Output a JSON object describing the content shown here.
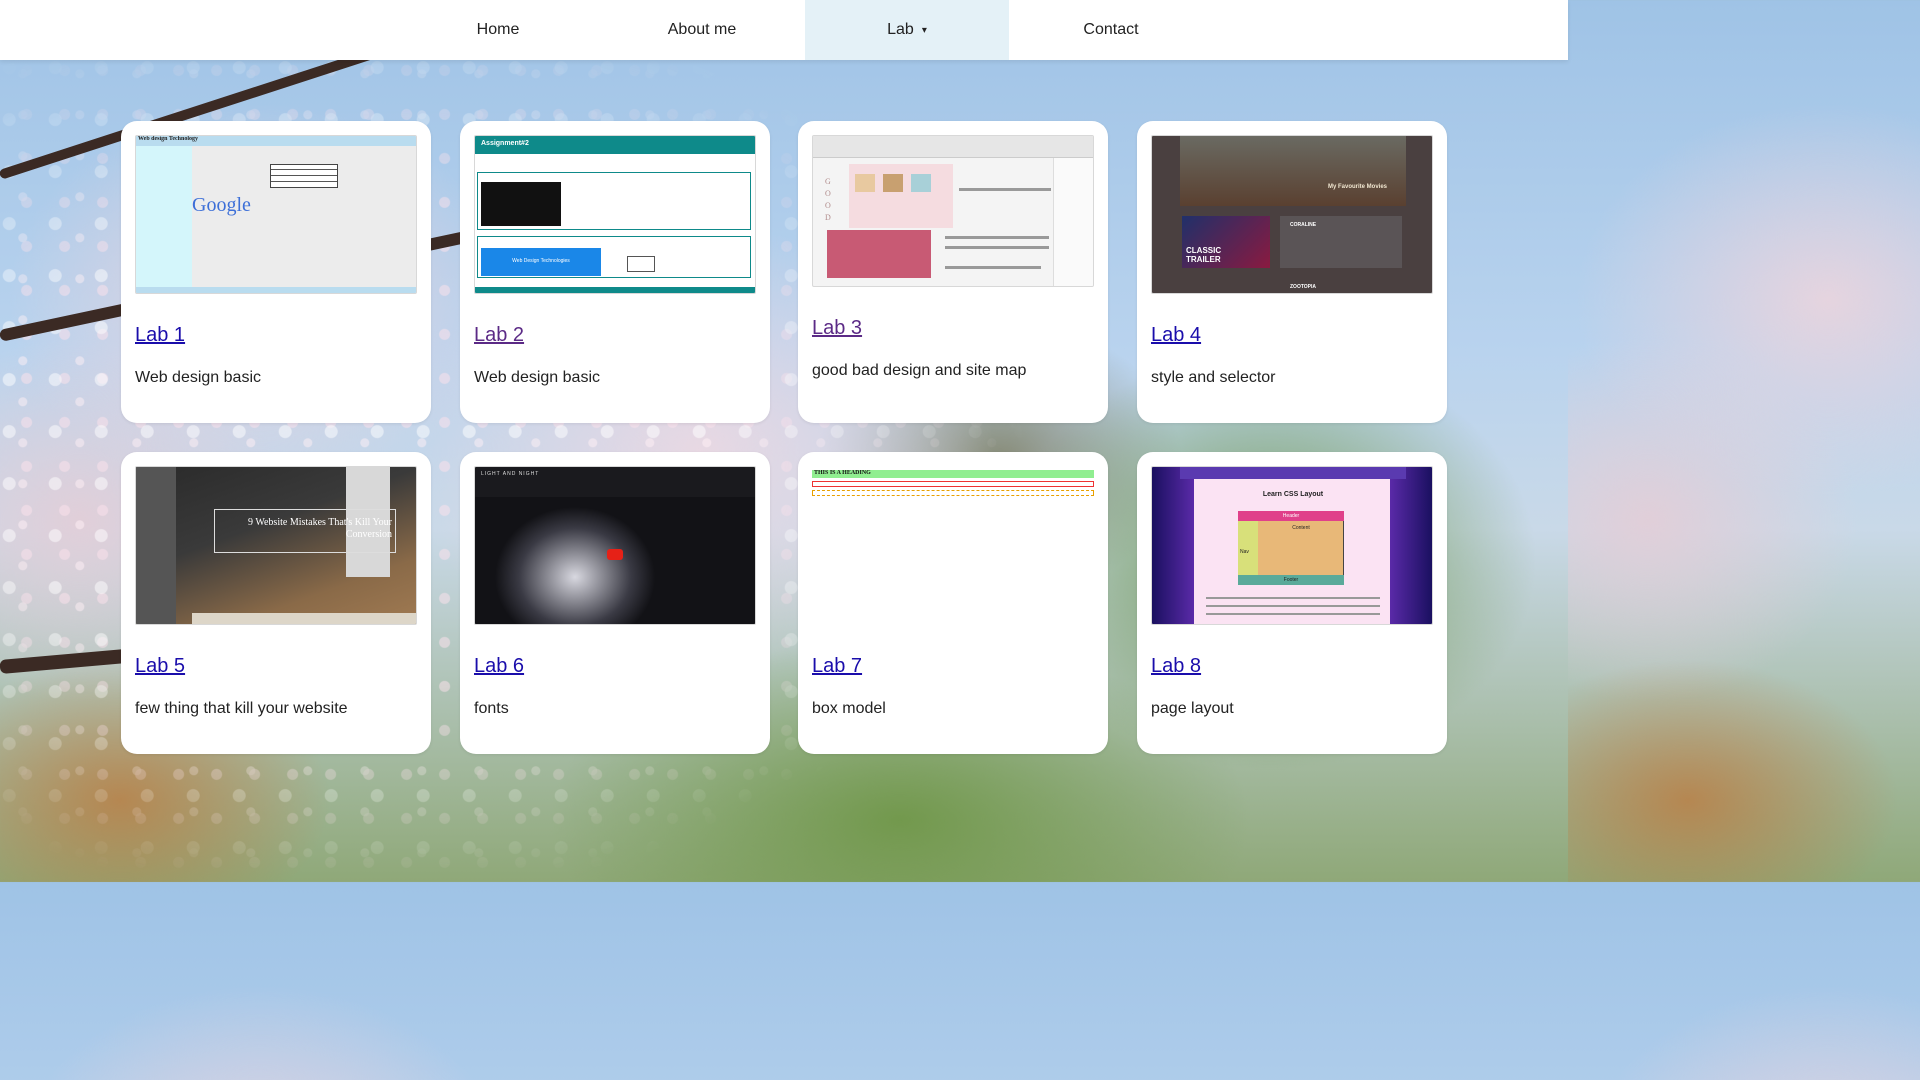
{
  "nav": {
    "items": [
      {
        "label": "Home"
      },
      {
        "label": "About me"
      },
      {
        "label": "Lab",
        "caret": "▾"
      },
      {
        "label": "Contact"
      }
    ]
  },
  "cards": [
    {
      "title": "Lab 1",
      "description": "Web design basic",
      "thumb": {
        "heading": "Web design Technology",
        "logo": "Google"
      }
    },
    {
      "title": "Lab 2",
      "description": "Web design basic",
      "thumb": {
        "heading": "Assignment#2",
        "button": "Web Design Technologies"
      }
    },
    {
      "title": "Lab 3",
      "description": "good bad design and site map",
      "thumb": {
        "side": "GOOD"
      }
    },
    {
      "title": "Lab 4",
      "description": "style and selector",
      "thumb": {
        "heading": "My Favourite Movies",
        "badge": "CLASSIC TRAILER",
        "item1": "CORALINE",
        "item2": "ZOOTOPIA"
      }
    },
    {
      "title": "Lab 5",
      "description": "few thing that kill your website",
      "thumb": {
        "headline": "9 Website Mistakes That's Kill Your Conversion"
      }
    },
    {
      "title": "Lab 6",
      "description": "fonts",
      "thumb": {
        "heading": "LIGHT AND NIGHT"
      }
    },
    {
      "title": "Lab 7",
      "description": "box model",
      "thumb": {
        "heading": "THIS IS A HEADING"
      }
    },
    {
      "title": "Lab 8",
      "description": "page layout",
      "thumb": {
        "heading": "Learn CSS Layout",
        "header": "Header",
        "nav": "Nav",
        "content": "Content",
        "footer": "Footer"
      }
    }
  ],
  "colors": {
    "nav_active_bg": "#e4f1f7",
    "link": "#1a0dab",
    "link_visited": "#5b2a86"
  }
}
